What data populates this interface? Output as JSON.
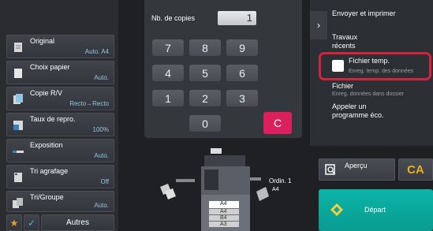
{
  "settings": [
    {
      "label": "Original",
      "value": "Auto. A4",
      "icon": "document-icon"
    },
    {
      "label": "Choix papier",
      "value": "Auto.",
      "icon": "paper-icon"
    },
    {
      "label": "Copie R/V",
      "value": "Recto→Recto",
      "icon": "duplex-icon"
    },
    {
      "label": "Taux de repro.",
      "value": "100%",
      "icon": "zoom-icon"
    },
    {
      "label": "Exposition",
      "value": "Auto.",
      "icon": "exposure-icon"
    },
    {
      "label": "Tri agrafage",
      "value": "Off",
      "icon": "staple-icon"
    },
    {
      "label": "Tri/Groupe",
      "value": "Auto.",
      "icon": "sort-icon"
    }
  ],
  "bottom_bar": {
    "others_label": "Autres"
  },
  "copies": {
    "label": "Nb. de copies",
    "value": "1"
  },
  "keypad": {
    "keys": [
      "7",
      "8",
      "9",
      "4",
      "5",
      "6",
      "1",
      "2",
      "3",
      "0"
    ],
    "clear_label": "C"
  },
  "menu": {
    "send_print": "Envoyer et imprimer",
    "recent_jobs_line1": "Travaux",
    "recent_jobs_line2": "récents",
    "temp_file_label": "Fichier temp.",
    "temp_file_sub": "Enreg. temp. des données",
    "file_label": "Fichier",
    "file_sub": "Enreg. données dans dossier",
    "eco_line1": "Appeler un",
    "eco_line2": "programme éco."
  },
  "machine": {
    "original_label": "Ordin. 1",
    "paper_size": "A4",
    "trays": [
      "A4",
      "A4",
      "B4",
      "A3"
    ]
  },
  "actions": {
    "preview_label": "Aperçu",
    "ca_label": "CA",
    "start_label": "Départ"
  },
  "colors": {
    "accent_start": "#0bb4a7",
    "clear_key": "#d8215d",
    "highlight": "#d8213a",
    "ca_text": "#e8b020"
  }
}
